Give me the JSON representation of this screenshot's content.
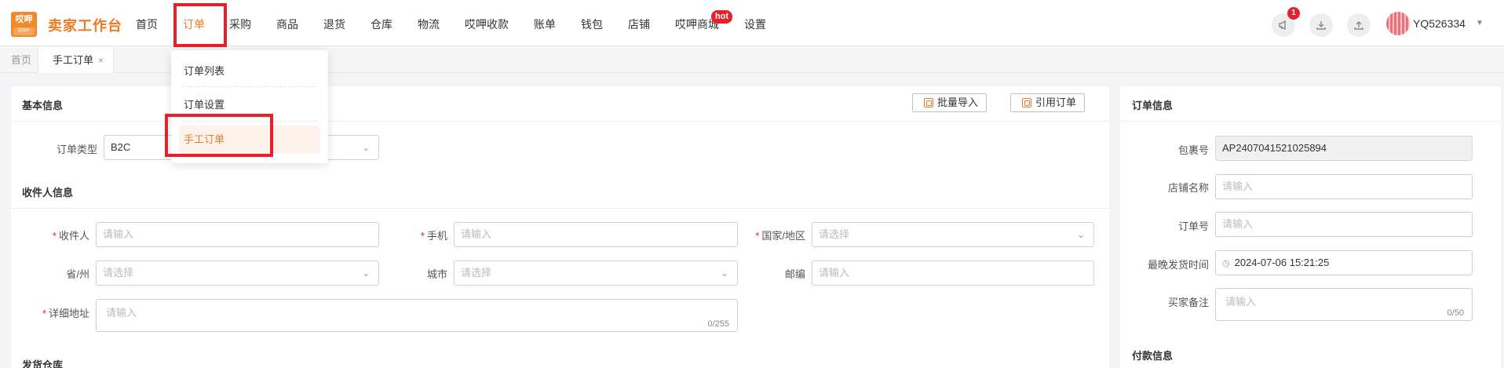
{
  "brand": {
    "logo_top": "哎呷",
    "logo_bottom": "ERP",
    "name": "卖家工作台"
  },
  "nav": {
    "items": [
      {
        "label": "首页"
      },
      {
        "label": "订单"
      },
      {
        "label": "采购"
      },
      {
        "label": "商品"
      },
      {
        "label": "退货"
      },
      {
        "label": "仓库"
      },
      {
        "label": "物流"
      },
      {
        "label": "哎呷收款"
      },
      {
        "label": "账单"
      },
      {
        "label": "钱包"
      },
      {
        "label": "店铺"
      },
      {
        "label": "哎呷商城"
      },
      {
        "label": "设置"
      }
    ],
    "hot_badge": "hot",
    "active": "订单"
  },
  "header_right": {
    "notification_count": "1",
    "username": "YQ526334"
  },
  "tabs": {
    "home": "首页",
    "current": "手工订单",
    "close": "×"
  },
  "dropdown": {
    "items": [
      "订单列表",
      "订单设置",
      "手工订单"
    ],
    "selected": "手工订单"
  },
  "basic_info": {
    "title": "基本信息",
    "batch_import": "批量导入",
    "cite_order": "引用订单",
    "order_type_label": "订单类型",
    "order_type_value": "B2C"
  },
  "recipient": {
    "title": "收件人信息",
    "name_label": "收件人",
    "name_placeholder": "请输入",
    "phone_label": "手机",
    "phone_placeholder": "请输入",
    "country_label": "国家/地区",
    "country_placeholder": "请选择",
    "province_label": "省/州",
    "province_placeholder": "请选择",
    "city_label": "城市",
    "city_placeholder": "请选择",
    "zip_label": "邮编",
    "zip_placeholder": "请输入",
    "address_label": "详细地址",
    "address_placeholder": "请输入",
    "address_count": "0/255",
    "required_mark": "*"
  },
  "warehouse": {
    "title": "发货仓库"
  },
  "order_info": {
    "title": "订单信息",
    "package_label": "包裹号",
    "package_value": "AP2407041521025894",
    "shop_label": "店铺名称",
    "shop_placeholder": "请输入",
    "order_no_label": "订单号",
    "order_no_placeholder": "请输入",
    "ship_time_label": "最晚发货时间",
    "ship_time_value": "2024-07-06 15:21:25",
    "remark_label": "买家备注",
    "remark_placeholder": "请输入",
    "remark_count": "0/50"
  },
  "payment": {
    "title": "付款信息"
  },
  "icons": [
    "megaphone-icon",
    "download-icon",
    "upload-icon",
    "clock-icon",
    "chevron-down-icon",
    "close-icon",
    "copy-icon"
  ]
}
